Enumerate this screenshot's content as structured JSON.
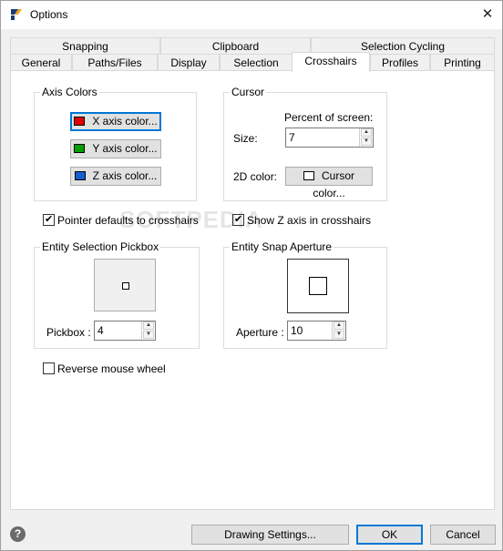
{
  "window": {
    "title": "Options",
    "close_glyph": "✕"
  },
  "tabs": {
    "row1": [
      "Snapping",
      "Clipboard",
      "Selection Cycling"
    ],
    "row2": [
      "General",
      "Paths/Files",
      "Display",
      "Selection",
      "Crosshairs",
      "Profiles",
      "Printing"
    ],
    "active": "Crosshairs"
  },
  "axis_colors": {
    "legend": "Axis Colors",
    "x_button": "X axis color...",
    "y_button": "Y axis color...",
    "z_button": "Z axis color...",
    "x_color": "#e00000",
    "y_color": "#00a000",
    "z_color": "#1560d0"
  },
  "cursor": {
    "legend": "Cursor",
    "percent_label": "Percent of screen:",
    "size_label": "Size:",
    "size_value": "7",
    "color_label": "2D color:",
    "color_button": "Cursor color...",
    "cursor_color": "#ffffff"
  },
  "checks": {
    "pointer_defaults": {
      "label": "Pointer defaults to crosshairs",
      "checked": true
    },
    "show_z_axis": {
      "label": "Show Z axis in crosshairs",
      "checked": true
    },
    "reverse_wheel": {
      "label": "Reverse mouse wheel",
      "checked": false
    }
  },
  "pickbox": {
    "legend": "Entity Selection Pickbox",
    "label": "Pickbox :",
    "value": "4"
  },
  "aperture": {
    "legend": "Entity Snap Aperture",
    "label": "Aperture :",
    "value": "10"
  },
  "footer": {
    "help_glyph": "?",
    "drawing_settings": "Drawing Settings...",
    "ok": "OK",
    "cancel": "Cancel"
  },
  "watermark": "SOFTPEDIA",
  "check_glyph": "✔",
  "spin_up": "▲",
  "spin_down": "▼"
}
